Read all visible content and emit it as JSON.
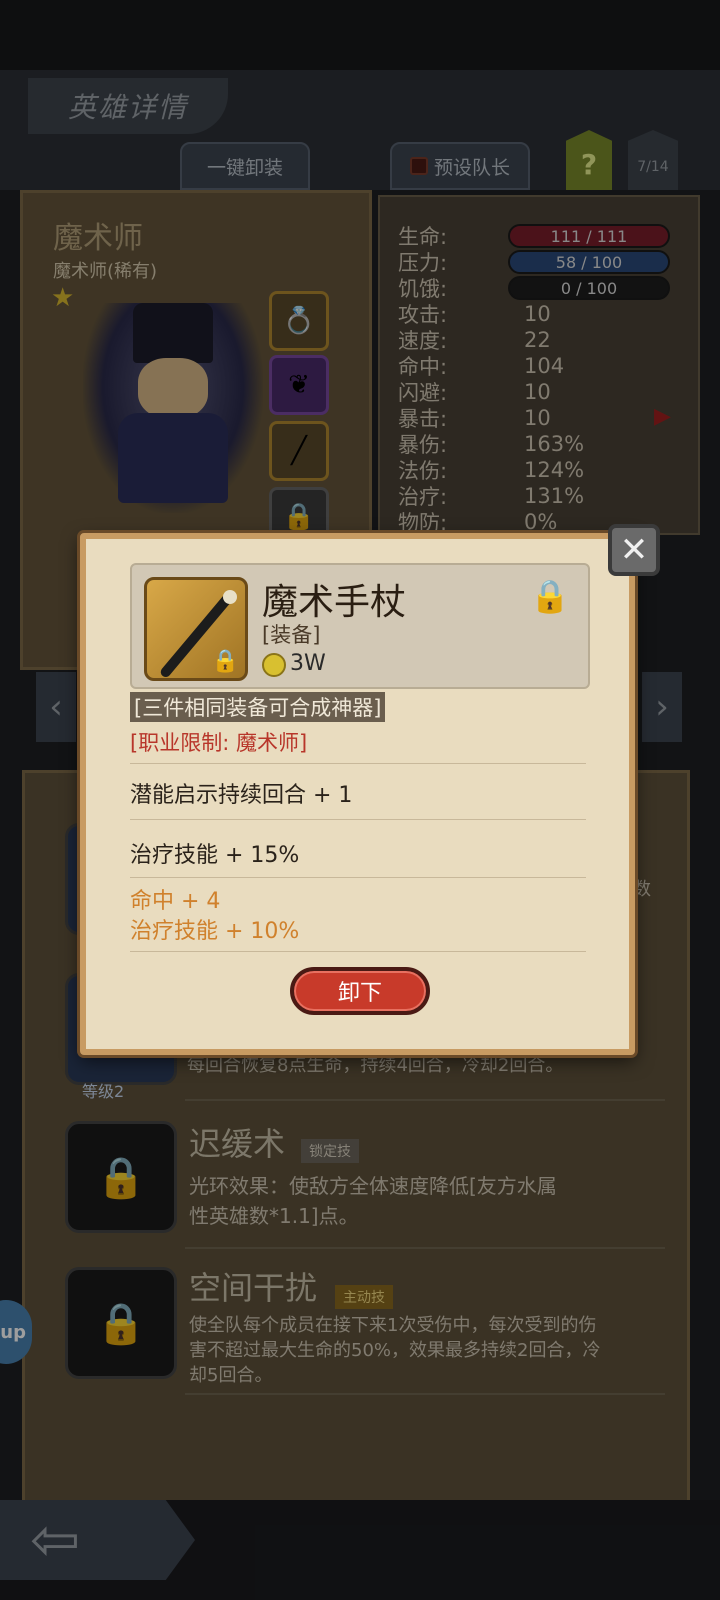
{
  "header": {
    "title": "英雄详情",
    "unequip_all": "一键卸装",
    "preset_leader": "预设队长",
    "help": "?",
    "count": "7/14"
  },
  "hero": {
    "name": "魔术师",
    "subtitle": "魔术师(稀有)",
    "stars": 1,
    "bars": [
      {
        "label": "生命:",
        "value": "111 / 111",
        "color": "#7a1e2a"
      },
      {
        "label": "压力:",
        "value": "58 / 100",
        "color": "#2a4a7a"
      },
      {
        "label": "饥饿:",
        "value": "0 / 100",
        "color": "#1e1e1e"
      }
    ],
    "stats": [
      {
        "label": "攻击:",
        "value": "10"
      },
      {
        "label": "速度:",
        "value": "22"
      },
      {
        "label": "命中:",
        "value": "104"
      },
      {
        "label": "闪避:",
        "value": "10"
      },
      {
        "label": "暴击:",
        "value": "10"
      },
      {
        "label": "暴伤:",
        "value": "163%"
      },
      {
        "label": "法伤:",
        "value": "124%"
      },
      {
        "label": "治疗:",
        "value": "131%"
      },
      {
        "label": "物防:",
        "value": "0%"
      }
    ]
  },
  "skills": {
    "partial_desc": "每回合恢复8点生命，持续4回合，冷却2回合。",
    "partial_level": "等级2",
    "partial_right": "数",
    "items": [
      {
        "name": "迟缓术",
        "tag": "锁定技",
        "desc_lines": [
          "光环效果：使敌方全体速度降低[友方水属",
          "性英雄数*1.1]点。"
        ]
      },
      {
        "name": "空间干扰",
        "tag": "主动技",
        "desc_lines": [
          "使全队每个成员在接下来1次受伤中，每次受到的伤",
          "害不超过最大生命的50%，效果最多持续2回合，冷",
          "却5回合。"
        ]
      }
    ]
  },
  "popup": {
    "item_name": "魔术手杖",
    "item_type": "[装备]",
    "price": "3W",
    "synth_note": "[三件相同装备可合成神器]",
    "restriction": "[职业限制: 魔术师]",
    "props": [
      "潜能启示持续回合 + 1",
      "治疗技能 + 15%"
    ],
    "bonus_props": [
      "命中 + 4",
      "治疗技能 + 10%"
    ],
    "unequip_button": "卸下"
  },
  "misc": {
    "app_bubble": "up"
  },
  "colors": {
    "popup_bg": "#e9dcbf",
    "orange_text": "#d0812c",
    "red_text": "#b8362a",
    "unequip_red": "#c83a2a"
  }
}
